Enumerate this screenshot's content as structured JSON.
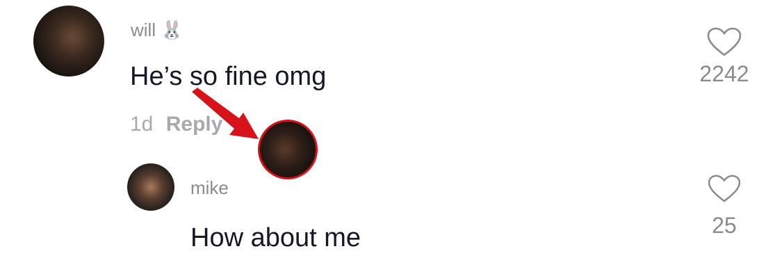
{
  "comments": [
    {
      "username": "will",
      "emoji": "🐰",
      "text": "He’s so fine omg",
      "age": "1d",
      "reply_label": "Reply",
      "likes": "2242"
    }
  ],
  "reply": {
    "username": "mike",
    "text": "How about me",
    "likes": "25"
  },
  "icons": {
    "like": "heart-outline-icon",
    "annotation": "red-arrow-icon"
  },
  "colors": {
    "accent": "#d6131b",
    "text_primary": "#161823",
    "text_secondary": "#8a8b91"
  }
}
